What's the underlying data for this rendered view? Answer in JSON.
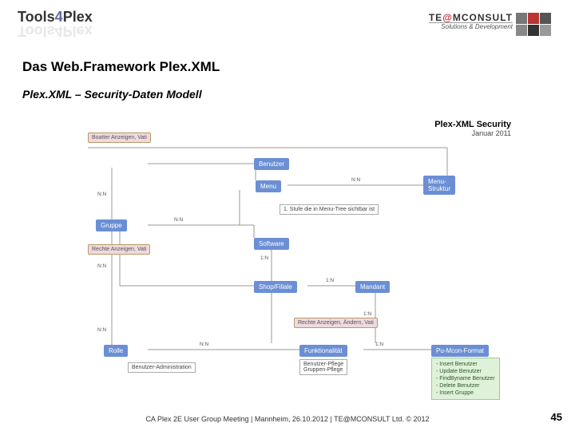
{
  "logo_left": "Tools4Plex",
  "logo_right": {
    "line1_a": "TE",
    "line1_at": "@",
    "line1_b": "MCONSULT",
    "line2": "Solutions & Development"
  },
  "title": "Das Web.Framework Plex.XML",
  "subtitle": "Plex.XML – Security-Daten Modell",
  "diagram_header": {
    "line1": "Plex-XML Security",
    "line2": "Januar 2011"
  },
  "entities": {
    "benutzer": "Benutzer",
    "gruppe": "Gruppe",
    "menu": "Menu",
    "menustruktur": "Menu-\nStruktur",
    "software": "Software",
    "shopfiliale": "Shop/Filiale",
    "mandant": "Mandant",
    "rolle": "Rolle",
    "funktionalitaet": "Funktionalität",
    "pluformat": "Pu-Mcon-Format"
  },
  "callouts": {
    "c1": "Boatter Anzeigen, Vati",
    "c2": "Rechte Anzeigen, Vati",
    "c3": "Rechte Anzeigen, Ändern, Vati"
  },
  "notes": {
    "stufe": "1. Stufe die in Menu-Tree sichtbar ist",
    "benadmin": "Benutzer-Administration",
    "bengrp": "Benutzer-Pflege\nGruppen-Pflege"
  },
  "greenbox": [
    "Insert Benutzer",
    "Update Benutzer",
    "FindByname Benutzer",
    "Delete Benutzer",
    "Insert Gruppe"
  ],
  "cards": {
    "nn": "N:N",
    "n1": "1:N"
  },
  "footer": "CA Plex 2E User Group Meeting | Mannheim, 26.10.2012 | TE@MCONSULT Ltd. © 2012",
  "page": "45"
}
